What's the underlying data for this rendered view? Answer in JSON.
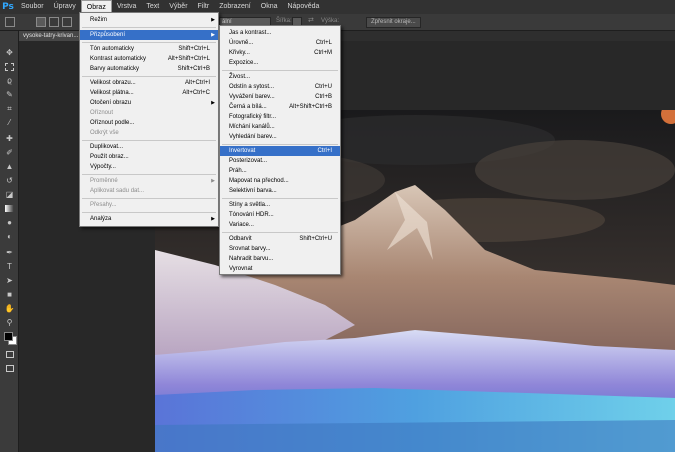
{
  "menubar": {
    "logo": "Ps",
    "items": [
      "Soubor",
      "Úpravy",
      "Obraz",
      "Vrstva",
      "Text",
      "Výběr",
      "Filtr",
      "Zobrazení",
      "Okna",
      "Nápověda"
    ]
  },
  "options_bar": {
    "field_value": "ální",
    "width_label": "Šířka:",
    "height_label": "Výška:",
    "refine_button": "Zpřesnit okraje..."
  },
  "document": {
    "tab_title": "vysoke-tatry-krivan..."
  },
  "image_menu": {
    "items": [
      {
        "label": "Režim",
        "shortcut": "",
        "submenu": true,
        "disabled": false
      },
      {
        "label": "Přizpůsobení",
        "shortcut": "",
        "submenu": true,
        "disabled": false,
        "highlighted": true
      },
      {
        "label": "Tón automaticky",
        "shortcut": "Shift+Ctrl+L",
        "disabled": false
      },
      {
        "label": "Kontrast automaticky",
        "shortcut": "Alt+Shift+Ctrl+L",
        "disabled": false
      },
      {
        "label": "Barvy automaticky",
        "shortcut": "Shift+Ctrl+B",
        "disabled": false
      },
      {
        "label": "Velikost obrazu...",
        "shortcut": "Alt+Ctrl+I",
        "disabled": false
      },
      {
        "label": "Velikost plátna...",
        "shortcut": "Alt+Ctrl+C",
        "disabled": false
      },
      {
        "label": "Otočení obrazu",
        "shortcut": "",
        "submenu": true,
        "disabled": false
      },
      {
        "label": "Oříznout",
        "shortcut": "",
        "disabled": true
      },
      {
        "label": "Oříznout podle...",
        "shortcut": "",
        "disabled": false
      },
      {
        "label": "Odkrýt vše",
        "shortcut": "",
        "disabled": true
      },
      {
        "label": "Duplikovat...",
        "shortcut": "",
        "disabled": false
      },
      {
        "label": "Použít obraz...",
        "shortcut": "",
        "disabled": false
      },
      {
        "label": "Výpočty...",
        "shortcut": "",
        "disabled": false
      },
      {
        "label": "Proměnné",
        "shortcut": "",
        "submenu": true,
        "disabled": true
      },
      {
        "label": "Aplikovat sadu dat...",
        "shortcut": "",
        "disabled": true
      },
      {
        "label": "Přesahy...",
        "shortcut": "",
        "disabled": true
      },
      {
        "label": "Analýza",
        "shortcut": "",
        "submenu": true,
        "disabled": false
      }
    ]
  },
  "adjust_menu": {
    "items": [
      {
        "label": "Jas a kontrast...",
        "shortcut": ""
      },
      {
        "label": "Úrovně...",
        "shortcut": "Ctrl+L"
      },
      {
        "label": "Křivky...",
        "shortcut": "Ctrl+M"
      },
      {
        "label": "Expozice...",
        "shortcut": ""
      },
      {
        "label": "Živost...",
        "shortcut": ""
      },
      {
        "label": "Odstín a sytost...",
        "shortcut": "Ctrl+U"
      },
      {
        "label": "Vyvážení barev...",
        "shortcut": "Ctrl+B"
      },
      {
        "label": "Černá a bílá...",
        "shortcut": "Alt+Shift+Ctrl+B"
      },
      {
        "label": "Fotografický filtr...",
        "shortcut": ""
      },
      {
        "label": "Míchání kanálů...",
        "shortcut": ""
      },
      {
        "label": "Vyhledání barev...",
        "shortcut": ""
      },
      {
        "label": "Invertovat",
        "shortcut": "Ctrl+I",
        "highlighted": true
      },
      {
        "label": "Posterizovat...",
        "shortcut": ""
      },
      {
        "label": "Práh...",
        "shortcut": ""
      },
      {
        "label": "Mapovat na přechod...",
        "shortcut": ""
      },
      {
        "label": "Selektivní barva...",
        "shortcut": ""
      },
      {
        "label": "Stíny a světla...",
        "shortcut": ""
      },
      {
        "label": "Tónování HDR...",
        "shortcut": ""
      },
      {
        "label": "Variace...",
        "shortcut": ""
      },
      {
        "label": "Odbarvit",
        "shortcut": "Shift+Ctrl+U"
      },
      {
        "label": "Srovnat barvy...",
        "shortcut": ""
      },
      {
        "label": "Nahradit barvu...",
        "shortcut": ""
      },
      {
        "label": "Vyrovnat",
        "shortcut": ""
      }
    ]
  },
  "tools": [
    "move-tool",
    "marquee-tool",
    "lasso-tool",
    "quick-select-tool",
    "crop-tool",
    "eyedropper-tool",
    "healing-tool",
    "brush-tool",
    "stamp-tool",
    "history-brush-tool",
    "eraser-tool",
    "gradient-tool",
    "blur-tool",
    "dodge-tool",
    "pen-tool",
    "type-tool",
    "path-select-tool",
    "shape-tool",
    "hand-tool",
    "zoom-tool"
  ],
  "colors": {
    "foreground": "#000000",
    "background": "#ffffff",
    "highlight": "#3670c8"
  }
}
